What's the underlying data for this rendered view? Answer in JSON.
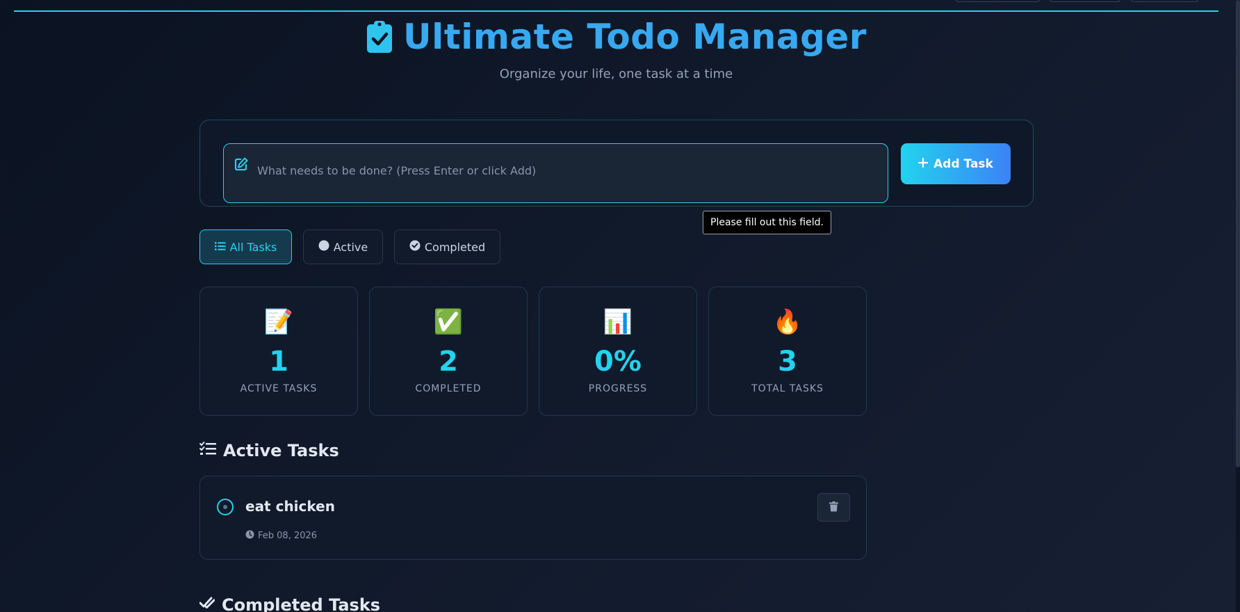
{
  "header": {
    "title": "Ultimate Todo Manager",
    "subtitle": "Organize your life, one task at a time"
  },
  "input": {
    "placeholder": "What needs to be done? (Press Enter or click Add)",
    "value": "",
    "add_label": "Add Task",
    "tooltip": "Please fill out this field."
  },
  "filters": [
    {
      "label": "All Tasks",
      "icon": "list-icon",
      "active": true
    },
    {
      "label": "Active",
      "icon": "circle-icon",
      "active": false
    },
    {
      "label": "Completed",
      "icon": "check-circle-icon",
      "active": false
    }
  ],
  "stats": [
    {
      "emoji": "📝",
      "value": "1",
      "label": "ACTIVE TASKS"
    },
    {
      "emoji": "✅",
      "value": "2",
      "label": "COMPLETED"
    },
    {
      "emoji": "📊",
      "value": "0%",
      "label": "PROGRESS"
    },
    {
      "emoji": "🔥",
      "value": "3",
      "label": "TOTAL TASKS"
    }
  ],
  "sections": {
    "active_title": "Active Tasks",
    "completed_title": "Completed Tasks"
  },
  "active_tasks": [
    {
      "title": "eat chicken",
      "date": "Feb 08, 2026"
    }
  ],
  "colors": {
    "accent": "#22d3ee",
    "title": "#38a8f0",
    "background": "#0b1322"
  }
}
